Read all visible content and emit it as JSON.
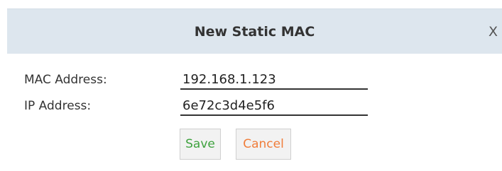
{
  "dialog": {
    "title": "New Static MAC",
    "close_label": "X"
  },
  "form": {
    "mac_label": "MAC Address:",
    "mac_value": "192.168.1.123",
    "ip_label": "IP Address:",
    "ip_value": "6e72c3d4e5f6"
  },
  "buttons": {
    "save_label": "Save",
    "cancel_label": "Cancel"
  },
  "colors": {
    "header_bg": "#dde6ee",
    "save_text": "#3fa23f",
    "cancel_text": "#f07d3a"
  }
}
